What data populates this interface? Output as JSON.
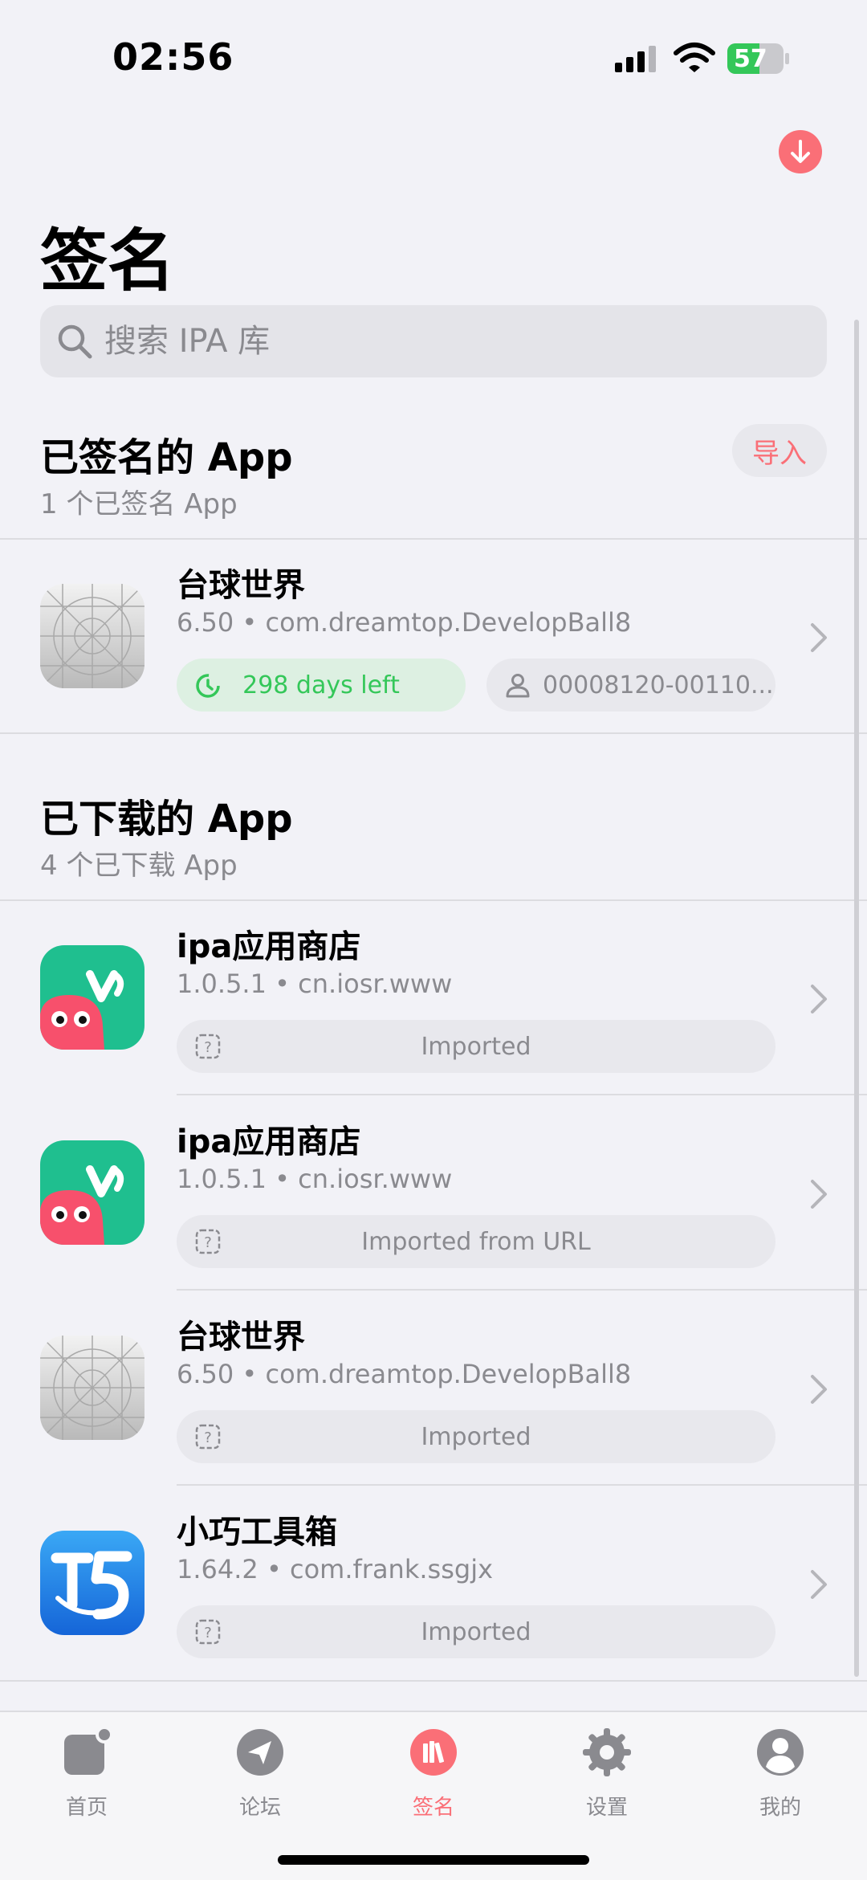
{
  "status": {
    "time": "02:56",
    "battery": "57",
    "battery_level": 0.57
  },
  "page": {
    "title": "签名"
  },
  "search": {
    "placeholder": "搜索 IPA 库"
  },
  "signed": {
    "title": "已签名的 App",
    "subtitle": "1 个已签名 App",
    "import_label": "导入",
    "apps": [
      {
        "name": "台球世界",
        "meta": "6.50 • com.dreamtop.DevelopBall8",
        "days_left": "298 days left",
        "device": "00008120-00110..."
      }
    ]
  },
  "downloaded": {
    "title": "已下载的 App",
    "subtitle": "4 个已下载 App",
    "apps": [
      {
        "name": "ipa应用商店",
        "meta": "1.0.5.1 • cn.iosr.www",
        "status": "Imported"
      },
      {
        "name": "ipa应用商店",
        "meta": "1.0.5.1 • cn.iosr.www",
        "status": "Imported from URL"
      },
      {
        "name": "台球世界",
        "meta": "6.50 • com.dreamtop.DevelopBall8",
        "status": "Imported"
      },
      {
        "name": "小巧工具箱",
        "meta": "1.64.2 • com.frank.ssgjx",
        "status": "Imported"
      }
    ]
  },
  "tabs": [
    {
      "label": "首页"
    },
    {
      "label": "论坛"
    },
    {
      "label": "签名"
    },
    {
      "label": "设置"
    },
    {
      "label": "我的"
    }
  ],
  "colors": {
    "accent": "#fa6f77",
    "success": "#34c759",
    "vine_green": "#1fbf8f",
    "tools_blue": "#1e88e5"
  }
}
